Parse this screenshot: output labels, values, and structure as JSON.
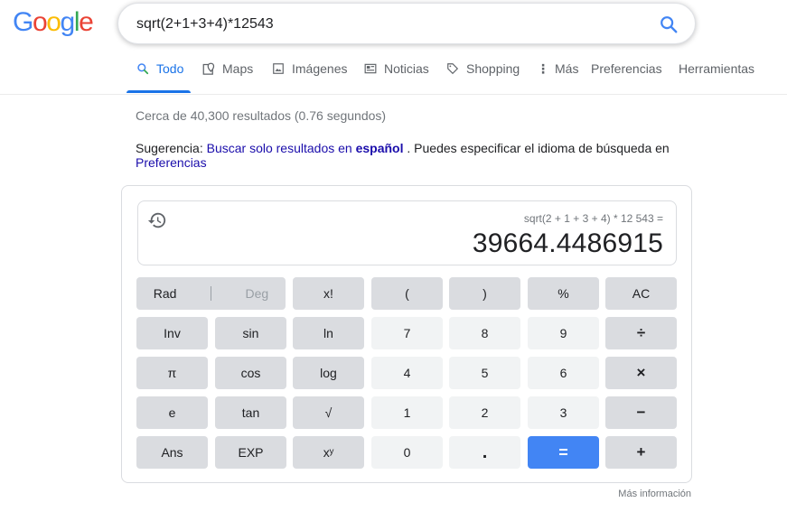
{
  "logo": {
    "letters": [
      "G",
      "o",
      "o",
      "g",
      "l",
      "e"
    ]
  },
  "search": {
    "query": "sqrt(2+1+3+4)*12543",
    "button_icon": "search-icon"
  },
  "tabs": [
    {
      "label": "Todo",
      "icon": "search-icon",
      "active": true
    },
    {
      "label": "Maps",
      "icon": "map-pin-icon"
    },
    {
      "label": "Imágenes",
      "icon": "image-icon"
    },
    {
      "label": "Noticias",
      "icon": "newspaper-icon"
    },
    {
      "label": "Shopping",
      "icon": "tag-icon"
    },
    {
      "label": "Más",
      "icon": "more-vert-icon"
    },
    {
      "label": "Preferencias"
    },
    {
      "label": "Herramientas"
    }
  ],
  "stats": "Cerca de 40,300 resultados (0.76 segundos)",
  "suggestion": {
    "prefix": "Sugerencia:",
    "link_text": "Buscar solo resultados en",
    "link_bold": "español",
    "middle": ". Puedes especificar el idioma de búsqueda en",
    "pref_link": "Preferencias"
  },
  "calculator": {
    "expression": "sqrt(2 + 1 + 3 + 4) * 12 543 =",
    "result": "39664.4486915",
    "keys": {
      "rad": "Rad",
      "deg": "Deg",
      "fact": "x!",
      "lparen": "(",
      "rparen": ")",
      "percent": "%",
      "ac": "AC",
      "inv": "Inv",
      "sin": "sin",
      "ln": "ln",
      "k7": "7",
      "k8": "8",
      "k9": "9",
      "div": "÷",
      "pi": "π",
      "cos": "cos",
      "log": "log",
      "k4": "4",
      "k5": "5",
      "k6": "6",
      "mul": "×",
      "e": "e",
      "tan": "tan",
      "sqrt": "√",
      "k1": "1",
      "k2": "2",
      "k3": "3",
      "minus": "−",
      "ans": "Ans",
      "exp": "EXP",
      "pow": "xʸ",
      "k0": "0",
      "dot": ".",
      "eq": "=",
      "plus": "+"
    }
  },
  "more_info": "Más información",
  "colors": {
    "accent": "#1a73e8",
    "link": "#1a0dab",
    "equals_key": "#4285f4"
  }
}
